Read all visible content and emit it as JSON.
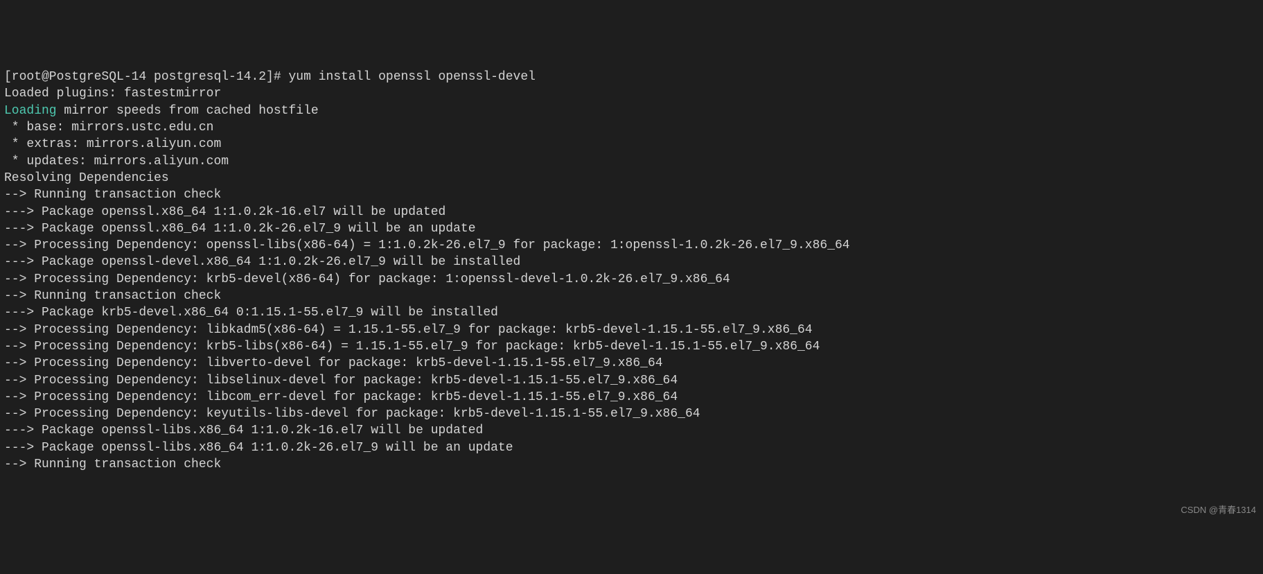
{
  "prompt": {
    "user_host": "[root@PostgreSQL-14 postgresql-14.2]#",
    "command": " yum install openssl openssl-devel"
  },
  "lines": [
    "Loaded plugins: fastestmirror",
    {
      "cyan": "Loading",
      "rest": " mirror speeds from cached hostfile"
    },
    " * base: mirrors.ustc.edu.cn",
    " * extras: mirrors.aliyun.com",
    " * updates: mirrors.aliyun.com",
    "Resolving Dependencies",
    "--> Running transaction check",
    "---> Package openssl.x86_64 1:1.0.2k-16.el7 will be updated",
    "---> Package openssl.x86_64 1:1.0.2k-26.el7_9 will be an update",
    "--> Processing Dependency: openssl-libs(x86-64) = 1:1.0.2k-26.el7_9 for package: 1:openssl-1.0.2k-26.el7_9.x86_64",
    "---> Package openssl-devel.x86_64 1:1.0.2k-26.el7_9 will be installed",
    "--> Processing Dependency: krb5-devel(x86-64) for package: 1:openssl-devel-1.0.2k-26.el7_9.x86_64",
    "--> Running transaction check",
    "---> Package krb5-devel.x86_64 0:1.15.1-55.el7_9 will be installed",
    "--> Processing Dependency: libkadm5(x86-64) = 1.15.1-55.el7_9 for package: krb5-devel-1.15.1-55.el7_9.x86_64",
    "--> Processing Dependency: krb5-libs(x86-64) = 1.15.1-55.el7_9 for package: krb5-devel-1.15.1-55.el7_9.x86_64",
    "--> Processing Dependency: libverto-devel for package: krb5-devel-1.15.1-55.el7_9.x86_64",
    "--> Processing Dependency: libselinux-devel for package: krb5-devel-1.15.1-55.el7_9.x86_64",
    "--> Processing Dependency: libcom_err-devel for package: krb5-devel-1.15.1-55.el7_9.x86_64",
    "--> Processing Dependency: keyutils-libs-devel for package: krb5-devel-1.15.1-55.el7_9.x86_64",
    "---> Package openssl-libs.x86_64 1:1.0.2k-16.el7 will be updated",
    "---> Package openssl-libs.x86_64 1:1.0.2k-26.el7_9 will be an update",
    "--> Running transaction check"
  ],
  "watermark": "CSDN @青春1314"
}
